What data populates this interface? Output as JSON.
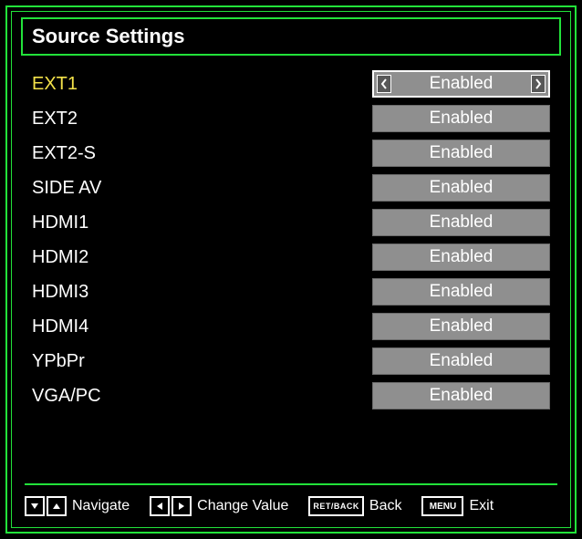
{
  "title": "Source Settings",
  "selected_index": 0,
  "items": [
    {
      "label": "EXT1",
      "value": "Enabled"
    },
    {
      "label": "EXT2",
      "value": "Enabled"
    },
    {
      "label": "EXT2-S",
      "value": "Enabled"
    },
    {
      "label": "SIDE AV",
      "value": "Enabled"
    },
    {
      "label": "HDMI1",
      "value": "Enabled"
    },
    {
      "label": "HDMI2",
      "value": "Enabled"
    },
    {
      "label": "HDMI3",
      "value": "Enabled"
    },
    {
      "label": "HDMI4",
      "value": "Enabled"
    },
    {
      "label": "YPbPr",
      "value": "Enabled"
    },
    {
      "label": "VGA/PC",
      "value": "Enabled"
    }
  ],
  "footer": {
    "navigate": "Navigate",
    "change_value": "Change Value",
    "back_btn": "RET/BACK",
    "back": "Back",
    "menu_btn": "MENU",
    "exit": "Exit"
  }
}
